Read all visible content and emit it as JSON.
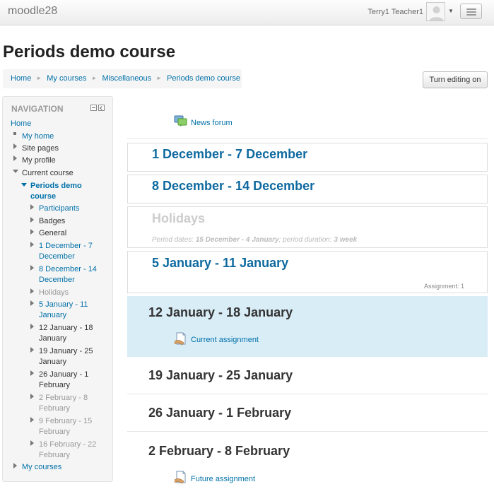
{
  "navbar": {
    "brand": "moodle28",
    "user": "Terry1 Teacher1"
  },
  "page": {
    "title": "Periods demo course"
  },
  "breadcrumb": [
    "Home",
    "My courses",
    "Miscellaneous",
    "Periods demo course"
  ],
  "edit_button": "Turn editing on",
  "navigation": {
    "title": "NAVIGATION",
    "items": [
      "Home",
      "My home",
      "Site pages",
      "My profile",
      "Current course",
      "Periods demo\ncourse",
      "Participants",
      "Badges",
      "General",
      "1 December - 7\nDecember",
      "8 December - 14\nDecember",
      "Holidays",
      "5 January - 11\nJanuary",
      "12 January - 18\nJanuary",
      "19 January - 25\nJanuary",
      "26 January - 1\nFebruary",
      "2 February - 8\nFebruary",
      "9 February - 15\nFebruary",
      "16 February - 22\nFebruary",
      "My courses"
    ]
  },
  "main": {
    "news_forum": "News forum",
    "sections": [
      {
        "title": "1 December - 7 December"
      },
      {
        "title": "8 December - 14 December"
      },
      {
        "title": "Holidays",
        "period_label": "Period dates:",
        "period_dates": "15 December - 4 January",
        "duration_label": "; period duration:",
        "duration": "3 week"
      },
      {
        "title": "5 January - 11 January",
        "summary": "Assignment: 1"
      },
      {
        "title": "12 January - 18 January",
        "activity": "Current assignment"
      },
      {
        "title": "19 January - 25 January"
      },
      {
        "title": "26 January - 1 February"
      },
      {
        "title": "2 February - 8 February",
        "activity": "Future assignment"
      }
    ]
  },
  "colors": {
    "link": "#0070a8",
    "current_section_bg": "#d9edf7"
  }
}
